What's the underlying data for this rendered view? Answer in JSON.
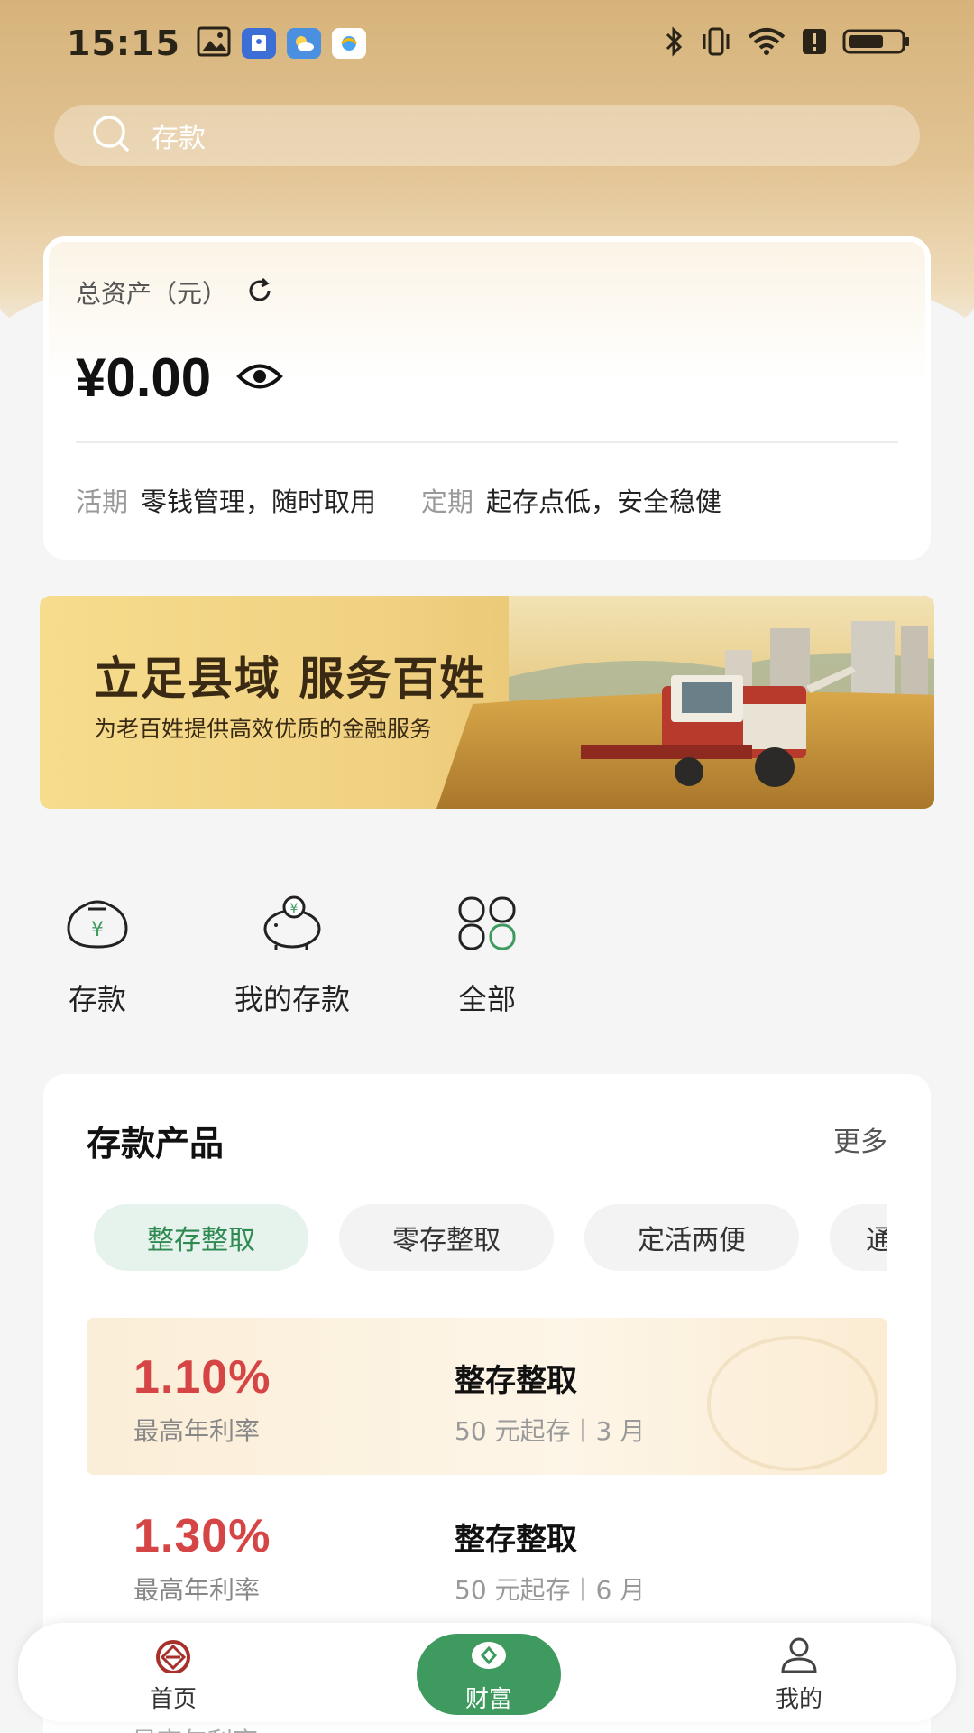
{
  "status_bar": {
    "time": "15:15"
  },
  "search": {
    "placeholder": "存款"
  },
  "asset": {
    "label": "总资产（元）",
    "amount": "¥0.00",
    "current_tag": "活期",
    "current_desc": "零钱管理，随时取用",
    "fixed_tag": "定期",
    "fixed_desc": "起存点低，安全稳健"
  },
  "banner": {
    "title": "立足县域 服务百姓",
    "subtitle": "为老百姓提供高效优质的金融服务"
  },
  "quick_entries": [
    {
      "label": "存款",
      "icon": "money-bag-icon"
    },
    {
      "label": "我的存款",
      "icon": "piggy-bank-icon"
    },
    {
      "label": "全部",
      "icon": "grid-apps-icon"
    }
  ],
  "products": {
    "title": "存款产品",
    "more": "更多",
    "tabs": [
      "整存整取",
      "零存整取",
      "定活两便",
      "通"
    ],
    "active_tab": 0,
    "items": [
      {
        "rate": "1.10%",
        "rate_label": "最高年利率",
        "name": "整存整取",
        "meta": "50 元起存丨3 月"
      },
      {
        "rate": "1.30%",
        "rate_label": "最高年利率",
        "name": "整存整取",
        "meta": "50 元起存丨6 月"
      }
    ],
    "peek_text": "最高年利率"
  },
  "bottom_nav": {
    "items": [
      {
        "label": "首页",
        "icon": "bank-logo-icon"
      },
      {
        "label": "财富",
        "icon": "wealth-icon"
      },
      {
        "label": "我的",
        "icon": "user-icon"
      }
    ],
    "active": 1
  },
  "colors": {
    "accent_green": "#3e9a5e",
    "rate_red": "#d64545",
    "gold": "#d6b37a"
  }
}
